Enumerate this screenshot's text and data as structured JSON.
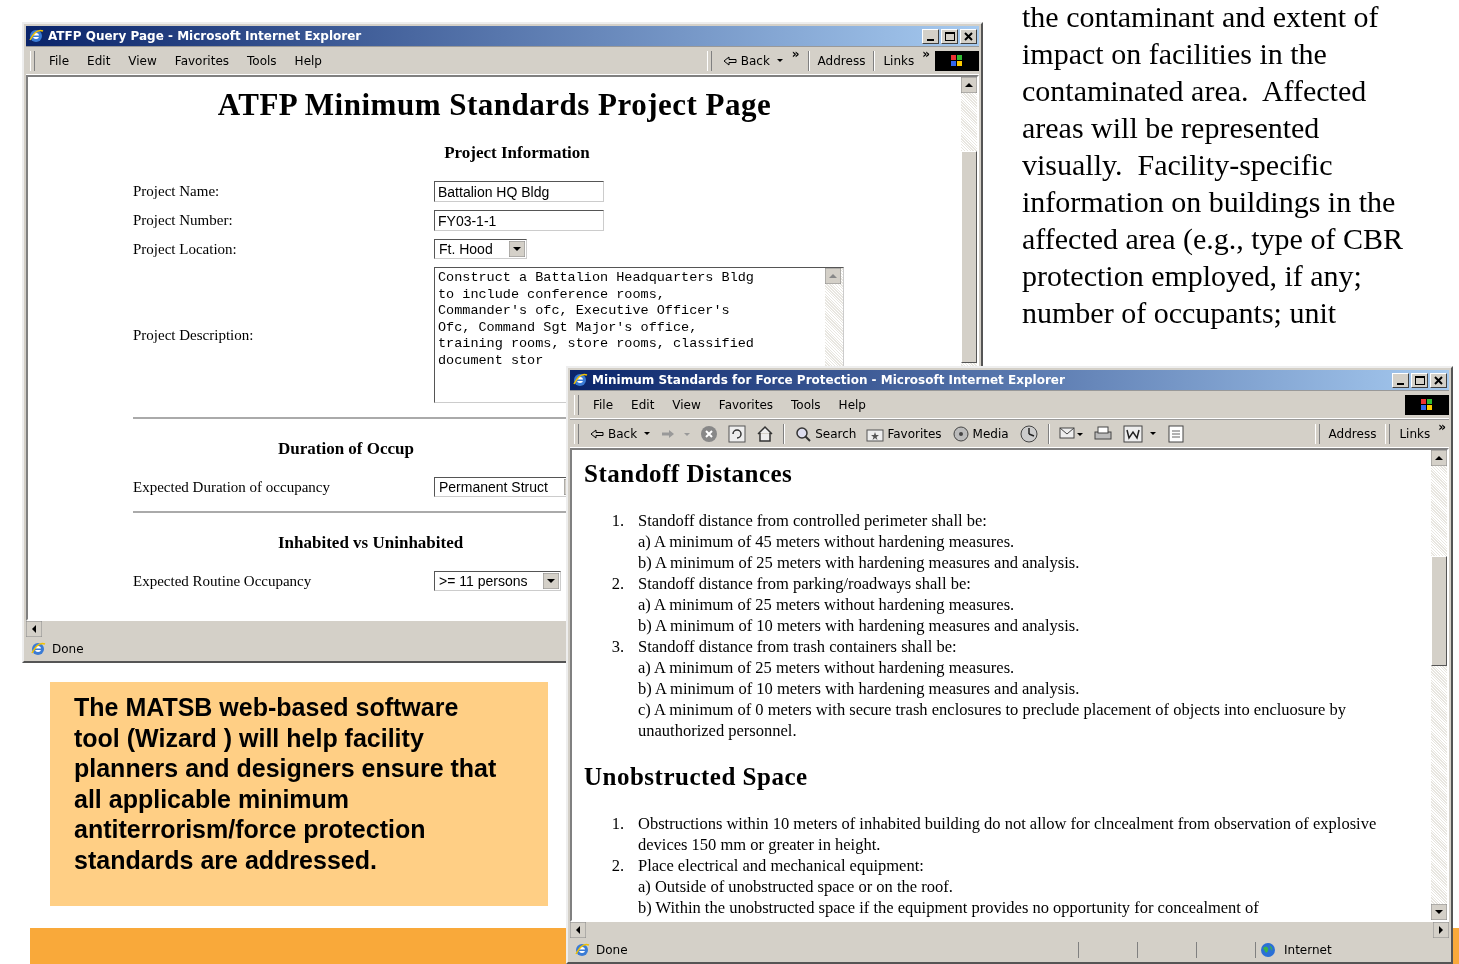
{
  "slide_text": "the contaminant and extent of\nimpact on facilities in the\ncontaminated area.  Affected\nareas will be represented\nvisually.  Facility-specific\ninformation on buildings in the\naffected area (e.g., type of CBR\nprotection employed, if any;\nnumber of occupants; unit",
  "callout": "The MATSB web-based software\ntool (Wizard ) will help facility\nplanners and designers ensure that\nall applicable minimum\nantiterrorism/force protection\nstandards are addressed.",
  "query_window": {
    "title": "ATFP Query Page - Microsoft Internet Explorer",
    "menu": [
      "File",
      "Edit",
      "View",
      "Favorites",
      "Tools",
      "Help"
    ],
    "toolbar": {
      "back": "Back",
      "more": "»",
      "address": "Address",
      "links": "Links",
      "links_more": "»"
    },
    "page": [
      {
        "kind": "heading",
        "text": "ATFP Minimum Standards Project Page"
      },
      {
        "kind": "section",
        "text": "Project Information"
      },
      {
        "kind": "text_field",
        "label": "Project Name:",
        "value": "Battalion HQ Bldg"
      },
      {
        "kind": "text_field",
        "label": "Project Number:",
        "value": "FY03-1-1"
      },
      {
        "kind": "select_field",
        "label": "Project Location:",
        "value": "Ft. Hood"
      },
      {
        "kind": "textarea_field",
        "label": "Project Description:",
        "value": "Construct a Battalion Headquarters Bldg\nto include conference rooms,\nCommander's ofc, Executive Officer's\nOfc, Command Sgt Major's office,\ntraining rooms, store rooms, classified\ndocument stor"
      },
      {
        "kind": "rule"
      },
      {
        "kind": "section",
        "text": "Duration of Occup"
      },
      {
        "kind": "select_field",
        "label": "Expected Duration of occupancy",
        "value": "Permanent Struct"
      },
      {
        "kind": "rule"
      },
      {
        "kind": "section",
        "text": "Inhabited vs Uninhabited"
      },
      {
        "kind": "select_field",
        "label": "Expected Routine Occupancy",
        "value": ">= 11 persons"
      }
    ],
    "status": "Done"
  },
  "standards_window": {
    "title": "Minimum Standards for Force Protection - Microsoft Internet Explorer",
    "menu": [
      "File",
      "Edit",
      "View",
      "Favorites",
      "Tools",
      "Help"
    ],
    "toolbar": {
      "back": "Back",
      "search": "Search",
      "favorites": "Favorites",
      "media": "Media",
      "address": "Address",
      "links": "Links",
      "links_more": "»"
    },
    "sections": [
      {
        "title": "Standoff Distances",
        "items": [
          {
            "number": "1.",
            "text": "Standoff distance from controlled perimeter shall be:",
            "subs": [
              "a) A minimum of 45 meters without hardening measures.",
              "b) A minimum of 25 meters with hardening measures and analysis."
            ]
          },
          {
            "number": "2.",
            "text": "Standoff distance from parking/roadways shall be:",
            "subs": [
              "a) A minimum of 25 meters without hardening measures.",
              "b) A minimum of 10 meters with hardening measures and analysis."
            ]
          },
          {
            "number": "3.",
            "text": "Standoff distance from trash containers shall be:",
            "subs": [
              "a) A minimum of 25 meters without hardening measures.",
              "b) A minimum of 10 meters with hardening measures and analysis.",
              "c) A minimum of 0 meters with secure trash enclosures to preclude placement of objects into encluosure by unauthorized personnel."
            ]
          }
        ]
      },
      {
        "title": "Unobstructed Space",
        "items": [
          {
            "number": "1.",
            "text": "Obstructions within 10 meters of inhabited building do not allow for clncealment from observation of explosive devices 150 mm or greater in height."
          },
          {
            "number": "2.",
            "text": "Place electrical and mechanical equipment:",
            "subs": [
              "a) Outside of unobstructed space or on the roof.",
              "b) Within the unobstructed space if the equipment provides no opportunity for concealment of"
            ]
          }
        ]
      }
    ],
    "status": "Done",
    "zone": "Internet"
  }
}
